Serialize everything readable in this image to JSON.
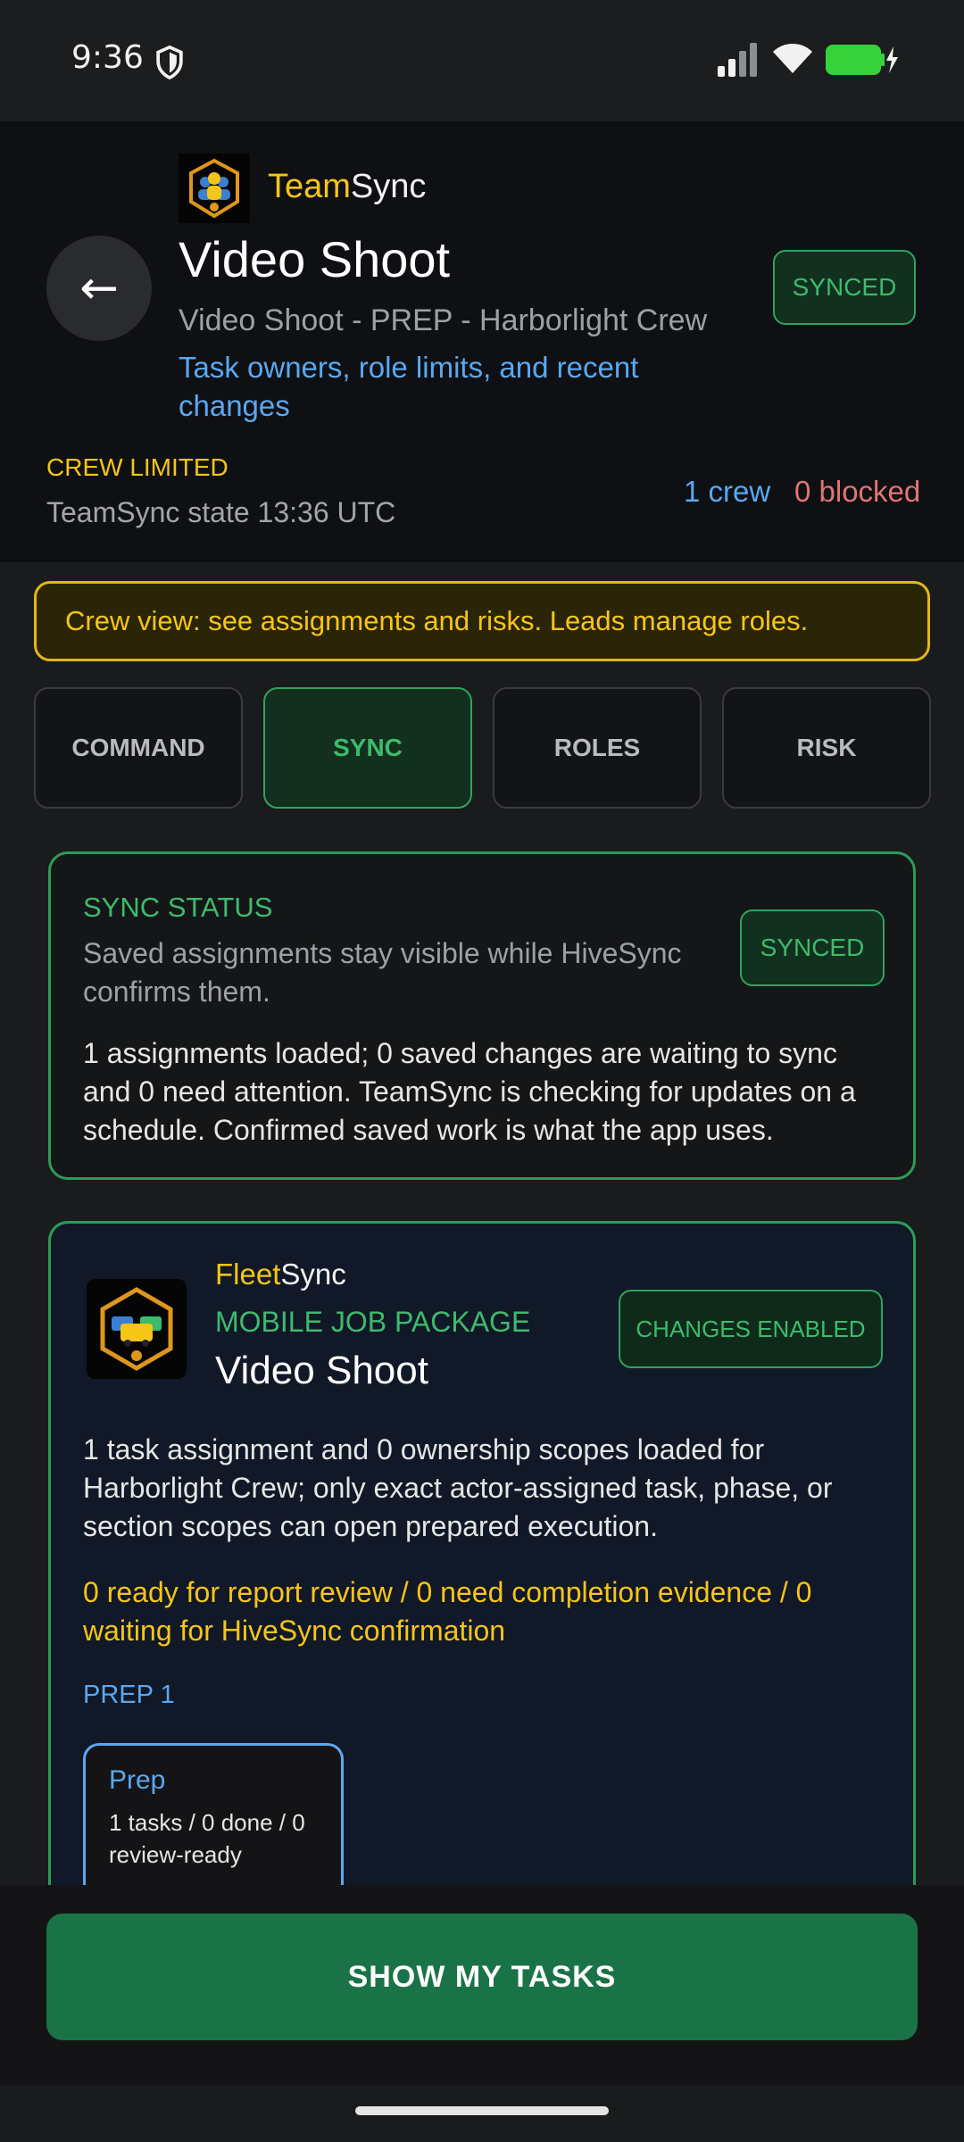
{
  "status_bar": {
    "time": "9:36",
    "icons": [
      "shield-icon",
      "signal-icon",
      "wifi-icon",
      "battery-charging-icon"
    ]
  },
  "header": {
    "back_icon": "arrow-left-icon",
    "brand_accent": "Team",
    "brand_rest": "Sync",
    "title": "Video Shoot",
    "subtitle": "Video Shoot - PREP - Harborlight Crew",
    "description": "Task owners, role limits, and recent changes",
    "sync_badge": "SYNCED",
    "crew_limited": "CREW LIMITED",
    "state_line": "TeamSync state 13:36 UTC",
    "crew_count": "1 crew",
    "blocked_count": "0 blocked"
  },
  "notice": {
    "text": "Crew view: see assignments and risks. Leads manage roles."
  },
  "tabs": [
    {
      "label": "COMMAND",
      "active": false
    },
    {
      "label": "SYNC",
      "active": true
    },
    {
      "label": "ROLES",
      "active": false
    },
    {
      "label": "RISK",
      "active": false
    }
  ],
  "sync_card": {
    "title": "SYNC STATUS",
    "subtitle": "Saved assignments stay visible while HiveSync confirms them.",
    "badge": "SYNCED",
    "body": "1 assignments loaded; 0 saved changes are waiting to sync and 0 need attention. TeamSync is checking for updates on a schedule. Confirmed saved work is what the app uses."
  },
  "fleet_card": {
    "brand_accent": "Fleet",
    "brand_rest": "Sync",
    "type": "MOBILE JOB PACKAGE",
    "title": "Video Shoot",
    "badge": "CHANGES ENABLED",
    "body": "1 task assignment and 0 ownership scopes loaded for Harborlight Crew; only exact actor-assigned task, phase, or section scopes can open prepared execution.",
    "warning": "0 ready for report review / 0 need completion evidence / 0 waiting for HiveSync confirmation",
    "phase_label": "PREP 1",
    "phase": {
      "name": "Prep",
      "stats": "1 tasks / 0 done / 0 review-ready"
    }
  },
  "bottom": {
    "cta": "SHOW MY TASKS"
  },
  "colors": {
    "accent_yellow": "#f5c518",
    "accent_green": "#3dbb6d",
    "accent_blue": "#5aa8f0",
    "danger_red": "#e07575",
    "cta_green": "#1a7346"
  }
}
